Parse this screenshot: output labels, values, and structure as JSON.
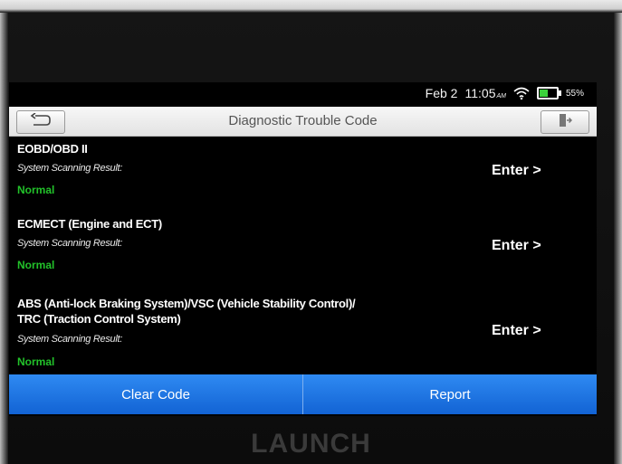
{
  "status": {
    "date": "Feb 2",
    "time": "11:05",
    "ampm": "AM",
    "battery": "55%",
    "battery_level": 0.55
  },
  "header": {
    "title": "Diagnostic Trouble Code"
  },
  "systems": [
    {
      "title_line1": "EOBD/OBD II",
      "title_line2": "",
      "subtitle": "System Scanning Result:",
      "status": "Normal",
      "action": "Enter >"
    },
    {
      "title_line1": "ECMECT (Engine and ECT)",
      "title_line2": "",
      "subtitle": "System Scanning Result:",
      "status": "Normal",
      "action": "Enter >"
    },
    {
      "title_line1": "ABS (Anti-lock Braking System)/VSC (Vehicle Stability Control)/",
      "title_line2": "TRC (Traction Control System)",
      "subtitle": "System Scanning Result:",
      "status": "Normal",
      "action": "Enter >"
    }
  ],
  "footer": {
    "clear_label": "Clear Code",
    "report_label": "Report"
  },
  "device": {
    "brand": "LAUNCH"
  },
  "colors": {
    "accent": "#1e74e0",
    "normal_status": "#22c22a",
    "battery_fill": "#3bd13b"
  }
}
